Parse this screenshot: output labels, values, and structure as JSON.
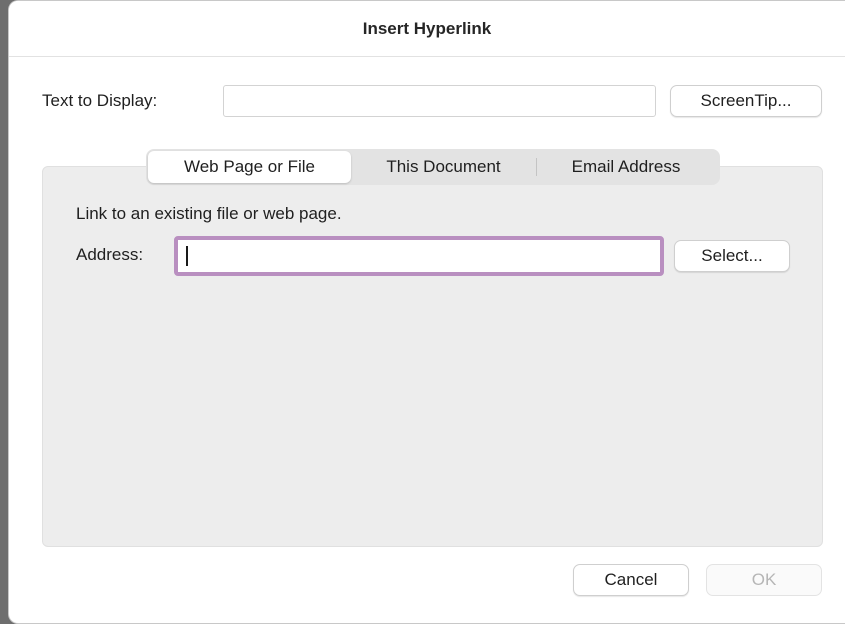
{
  "dialog": {
    "title": "Insert Hyperlink"
  },
  "display": {
    "label": "Text to Display:",
    "value": "",
    "screentip_label": "ScreenTip..."
  },
  "tabs": [
    {
      "label": "Web Page or File",
      "active": true
    },
    {
      "label": "This Document",
      "active": false
    },
    {
      "label": "Email Address",
      "active": false
    }
  ],
  "panel": {
    "description": "Link to an existing file or web page.",
    "address_label": "Address:",
    "address_value": "",
    "select_label": "Select..."
  },
  "footer": {
    "cancel_label": "Cancel",
    "ok_label": "OK",
    "ok_enabled": false
  },
  "colors": {
    "focus_ring": "#b98fc0",
    "panel_bg": "#ededed"
  }
}
